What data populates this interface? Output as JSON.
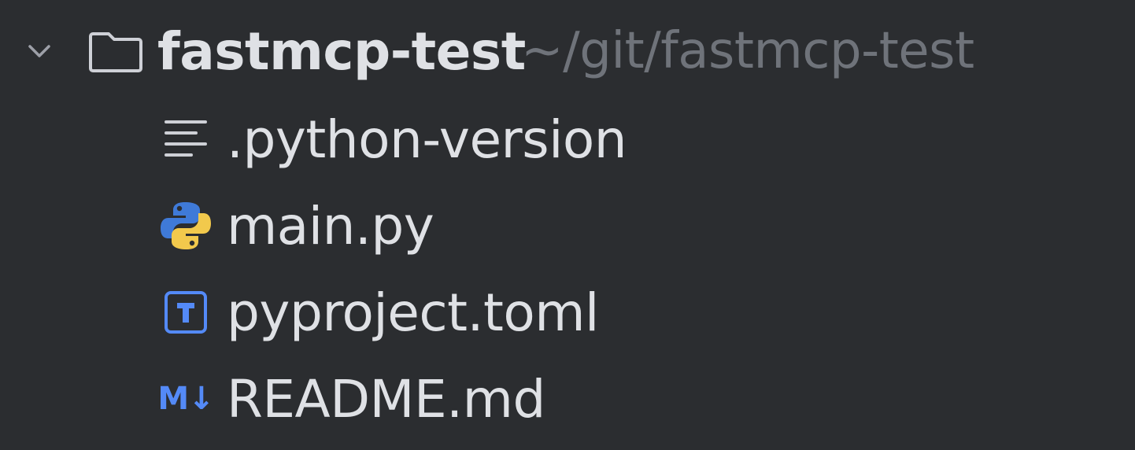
{
  "project_tree": {
    "root": {
      "name": "fastmcp-test",
      "path": "~/git/fastmcp-test",
      "expanded": true,
      "chevron_icon": "chevron-down-icon",
      "folder_icon": "folder-icon"
    },
    "files": [
      {
        "name": ".python-version",
        "icon": "text-file-icon"
      },
      {
        "name": "main.py",
        "icon": "python-icon"
      },
      {
        "name": "pyproject.toml",
        "icon": "toml-icon"
      },
      {
        "name": "README.md",
        "icon": "markdown-icon",
        "icon_text": "M↓"
      }
    ]
  },
  "colors": {
    "background": "#2b2d30",
    "text": "#dfe1e5",
    "muted_text": "#6f737a",
    "icon_gray": "#ced0d6",
    "accent_blue": "#548af7",
    "python_blue": "#3f7ad8",
    "python_yellow": "#f2c94c"
  }
}
